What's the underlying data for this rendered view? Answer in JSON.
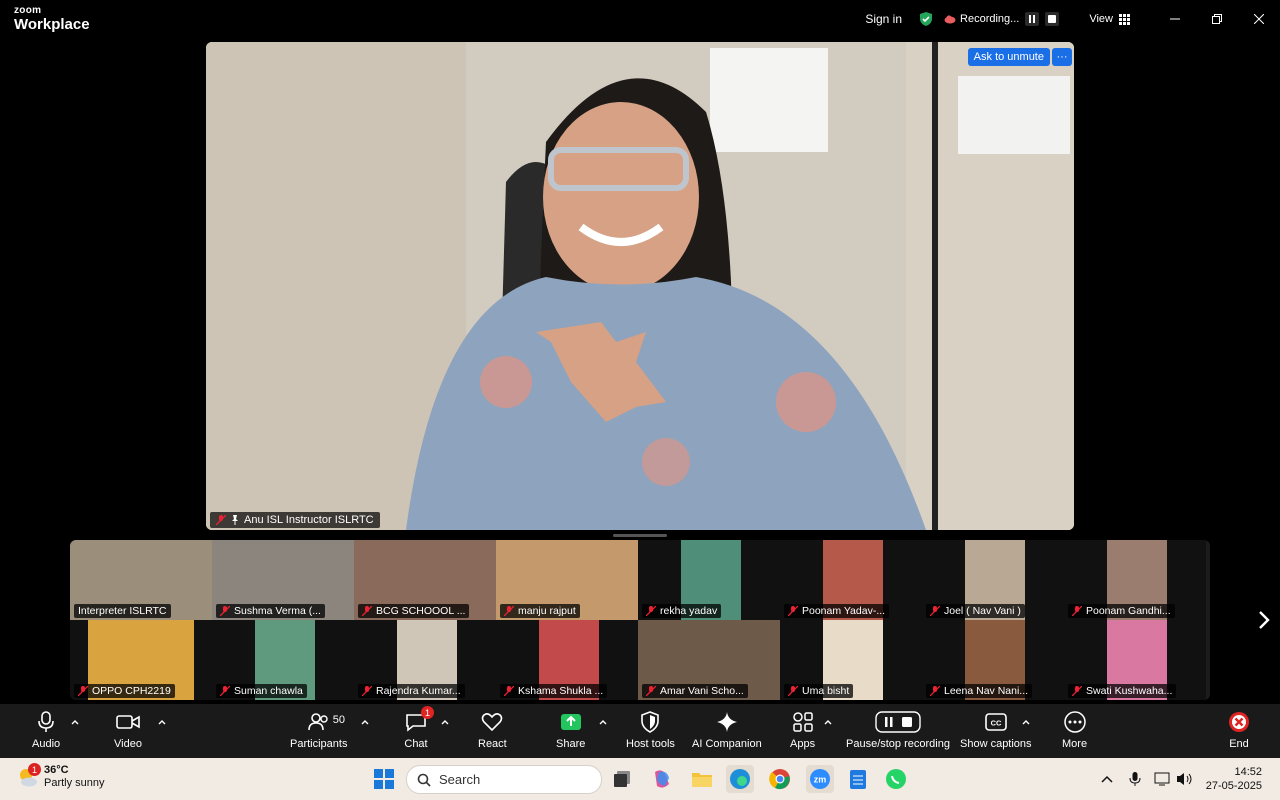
{
  "app": {
    "logo_top": "zoom",
    "logo_bottom": "Workplace"
  },
  "titlebar": {
    "signin": "Sign in",
    "recording": "Recording...",
    "view": "View"
  },
  "main": {
    "ask_unmute": "Ask to unmute",
    "more": "···",
    "speaker": "Anu ISL Instructor ISLRTC"
  },
  "gallery": [
    "Interpreter  ISLRTC",
    "Sushma Verma (...",
    "BCG SCHOOOL ...",
    "manju rajput",
    "rekha yadav",
    "Poonam Yadav-...",
    "Joel ( Nav Vani )",
    "Poonam Gandhi...",
    "OPPO CPH2219",
    "Suman chawla",
    "Rajendra Kumar...",
    "Kshama Shukla ...",
    "Amar Vani Scho...",
    "Uma bisht",
    "Leena Nav Nani...",
    "Swati Kushwaha..."
  ],
  "toolbar": {
    "audio": "Audio",
    "video": "Video",
    "participants": "Participants",
    "participants_count": "50",
    "chat": "Chat",
    "chat_badge": "1",
    "react": "React",
    "share": "Share",
    "host_tools": "Host tools",
    "ai": "AI Companion",
    "apps": "Apps",
    "pause": "Pause/stop recording",
    "captions": "Show captions",
    "more": "More",
    "end": "End"
  },
  "taskbar": {
    "temp": "36°C",
    "weather": "Partly sunny",
    "weather_badge": "1",
    "search": "Search",
    "time": "14:52",
    "date": "27-05-2025"
  },
  "colors": {
    "accent": "#1a6ee6",
    "end": "#e02424",
    "share": "#22c55e"
  }
}
